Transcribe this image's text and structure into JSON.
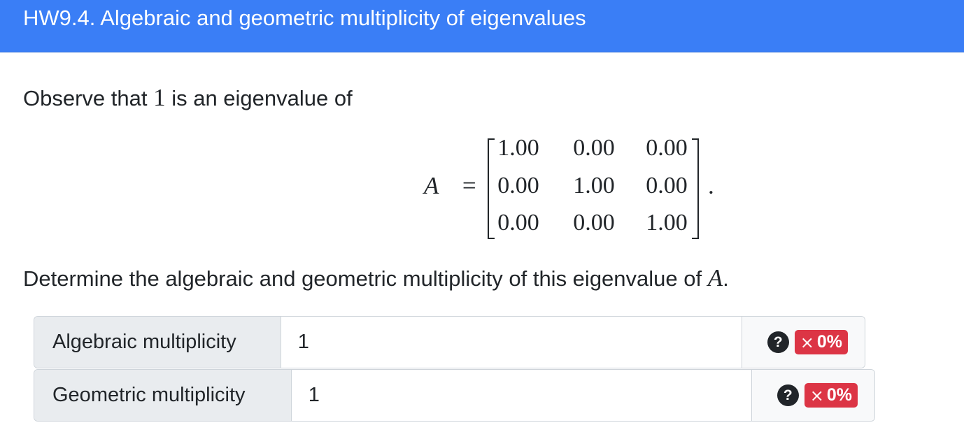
{
  "header": {
    "title": "HW9.4. Algebraic and geometric multiplicity of eigenvalues"
  },
  "prompt": {
    "intro_before": "Observe that ",
    "eigenvalue": "1",
    "intro_after": " is an eigenvalue of",
    "matrix_name": "A",
    "equals": "=",
    "period": ".",
    "matrix": [
      [
        "1.00",
        "0.00",
        "0.00"
      ],
      [
        "0.00",
        "1.00",
        "0.00"
      ],
      [
        "0.00",
        "0.00",
        "1.00"
      ]
    ],
    "question_before": "Determine the algebraic and geometric multiplicity of this eigenvalue of ",
    "question_var": "A",
    "question_after": "."
  },
  "answers": [
    {
      "label": "Algebraic multiplicity",
      "value": "1",
      "help_icon": "question-circle-icon",
      "help_text": "?",
      "score_icon": "×",
      "score": "0%"
    },
    {
      "label": "Geometric multiplicity",
      "value": "1",
      "help_icon": "question-circle-icon",
      "help_text": "?",
      "score_icon": "×",
      "score": "0%"
    }
  ],
  "colors": {
    "header_bg": "#3a7ef6",
    "score_badge": "#dc3545",
    "label_bg": "#e9ecef"
  }
}
